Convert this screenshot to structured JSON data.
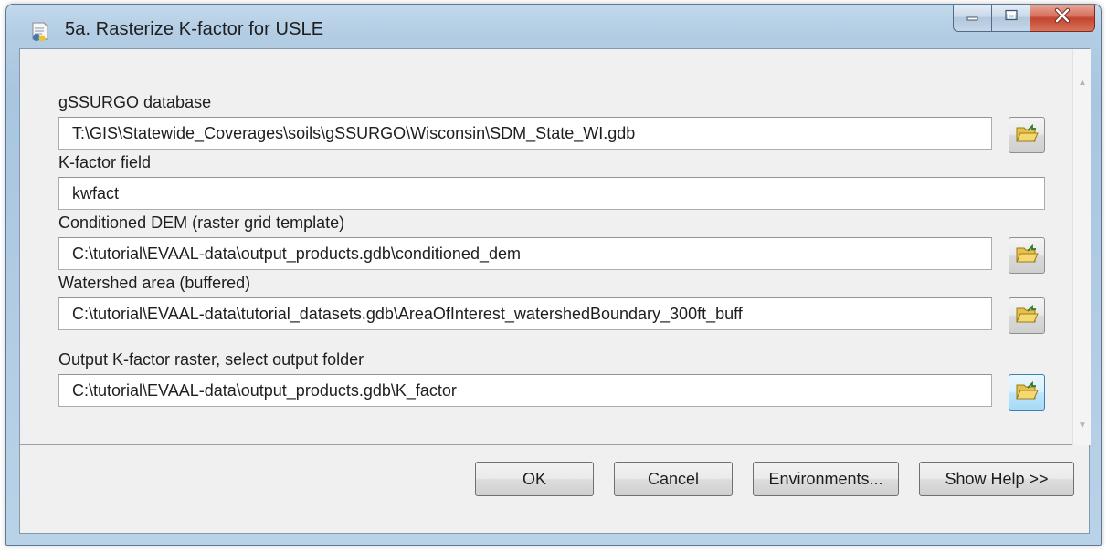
{
  "window": {
    "title": "5a. Rasterize K-factor for USLE"
  },
  "params": [
    {
      "label": "gSSURGO database",
      "value": "T:\\GIS\\Statewide_Coverages\\soils\\gSSURGO\\Wisconsin\\SDM_State_WI.gdb"
    },
    {
      "label": "K-factor field",
      "value": "kwfact"
    },
    {
      "label": "Conditioned DEM (raster grid template)",
      "value": "C:\\tutorial\\EVAAL-data\\output_products.gdb\\conditioned_dem"
    },
    {
      "label": "Watershed area (buffered)",
      "value": "C:\\tutorial\\EVAAL-data\\tutorial_datasets.gdb\\AreaOfInterest_watershedBoundary_300ft_buff"
    },
    {
      "label": "Output K-factor raster, select output folder",
      "value": "C:\\tutorial\\EVAAL-data\\output_products.gdb\\K_factor"
    }
  ],
  "buttons": {
    "ok": "OK",
    "cancel": "Cancel",
    "environments": "Environments...",
    "help": "Show Help >>"
  },
  "icons": {
    "app": "python-script-icon",
    "browse": "open-folder-icon",
    "minimize": "minimize-icon",
    "maximize": "maximize-icon",
    "close": "close-icon"
  },
  "colors": {
    "titlebar": "#b3cde4",
    "close_button": "#c3452f",
    "dialog_background": "#f0f0f0",
    "focus_button": "#bee6fd"
  }
}
